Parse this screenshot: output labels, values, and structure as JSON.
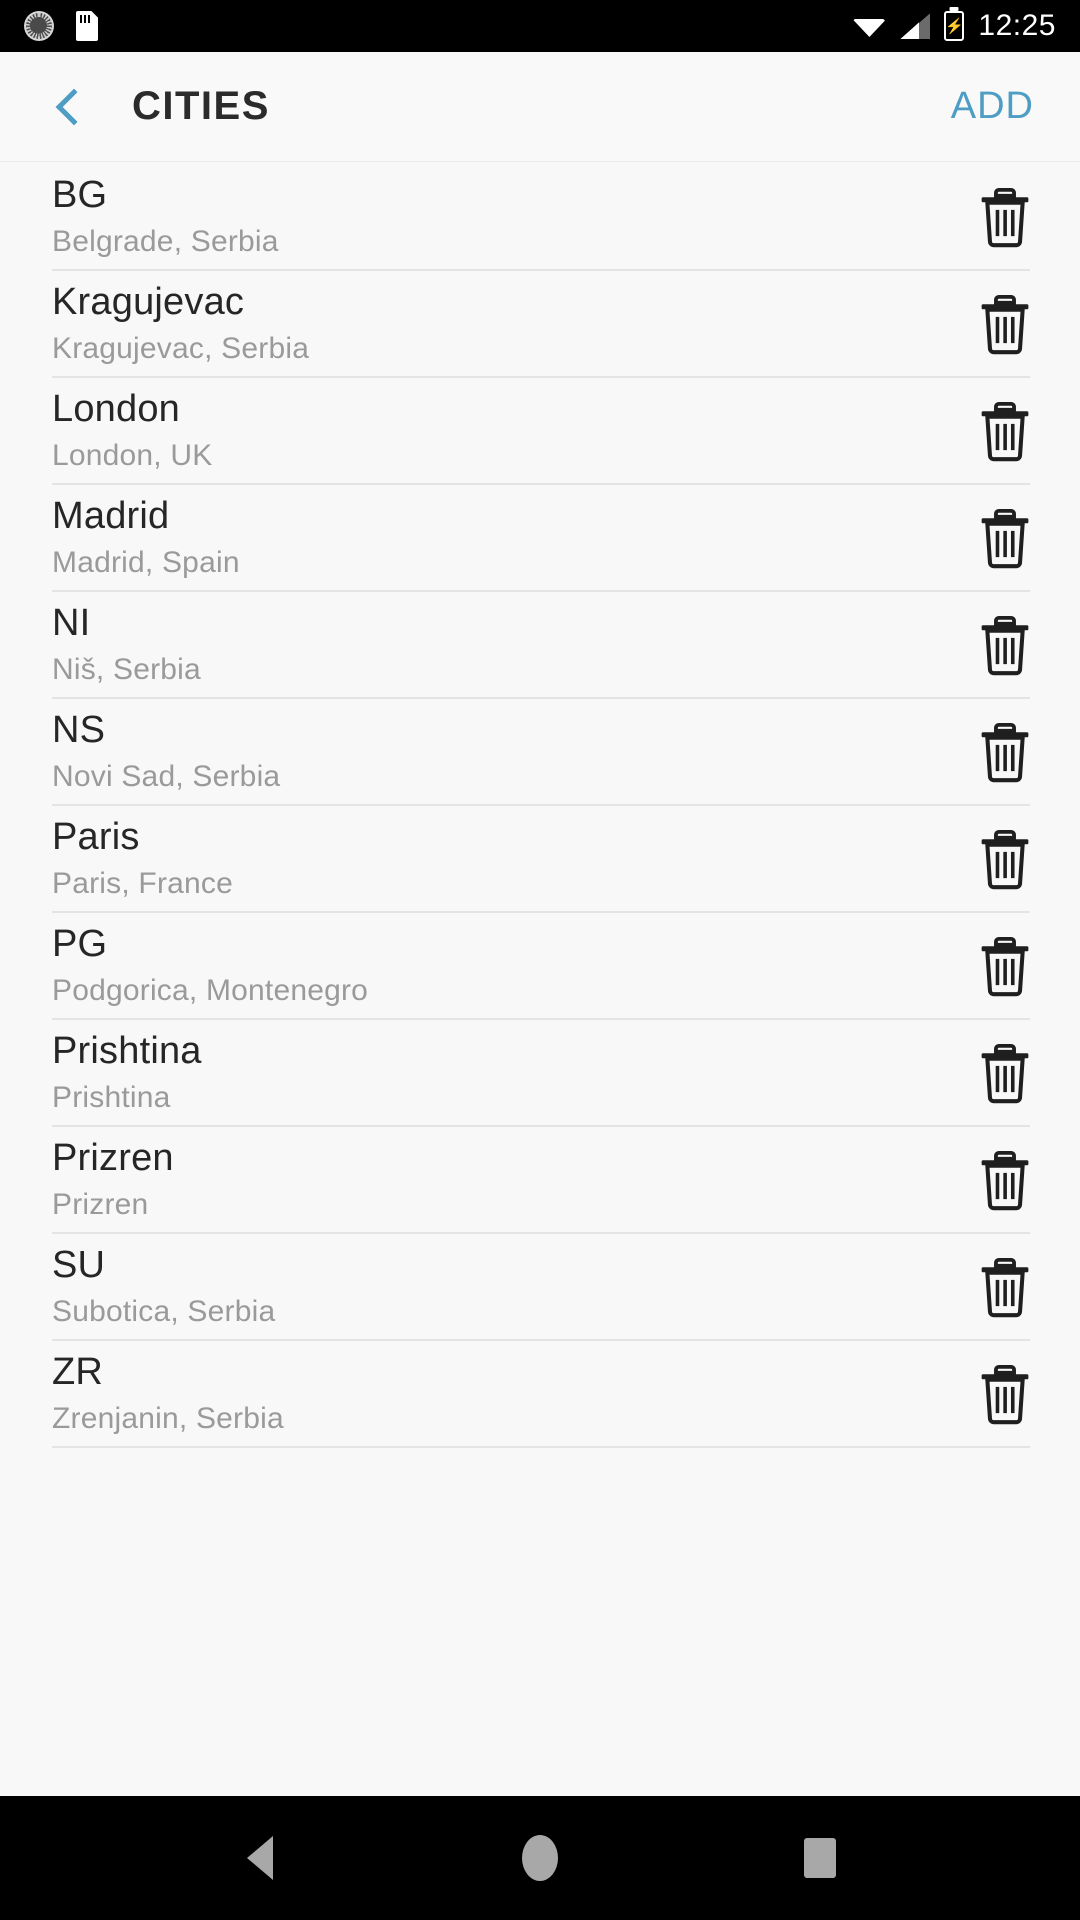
{
  "status_bar": {
    "time": "12:25",
    "left_icons": [
      "sync-icon",
      "sd-card-icon"
    ],
    "right_icons": [
      "wifi-icon",
      "cellular-signal-icon",
      "battery-charging-icon"
    ],
    "background_color": "#000000"
  },
  "app_bar": {
    "back_label": "back-chevron-icon",
    "title": "CITIES",
    "action_label": "ADD",
    "accent_color": "#4d9dc4",
    "title_color": "#2b2b2b",
    "background_color": "#f9f9f9"
  },
  "list": {
    "delete_icon": "trash-icon",
    "divider_color": "#e4e4e4",
    "title_color": "#262626",
    "subtitle_color": "#9a9a9a",
    "rows": [
      {
        "title": "BG",
        "subtitle": "Belgrade, Serbia"
      },
      {
        "title": "Kragujevac",
        "subtitle": "Kragujevac, Serbia"
      },
      {
        "title": "London",
        "subtitle": "London, UK"
      },
      {
        "title": "Madrid",
        "subtitle": "Madrid, Spain"
      },
      {
        "title": "NI",
        "subtitle": "Niš, Serbia"
      },
      {
        "title": "NS",
        "subtitle": "Novi Sad, Serbia"
      },
      {
        "title": "Paris",
        "subtitle": "Paris, France"
      },
      {
        "title": "PG",
        "subtitle": "Podgorica, Montenegro"
      },
      {
        "title": "Prishtina",
        "subtitle": "Prishtina"
      },
      {
        "title": "Prizren",
        "subtitle": "Prizren"
      },
      {
        "title": "SU",
        "subtitle": "Subotica, Serbia"
      },
      {
        "title": "ZR",
        "subtitle": "Zrenjanin, Serbia"
      }
    ]
  },
  "nav_bar": {
    "buttons": [
      "back-triangle-icon",
      "home-circle-icon",
      "recents-square-icon"
    ],
    "background_color": "#000000",
    "icon_color": "#a8a8a8"
  }
}
